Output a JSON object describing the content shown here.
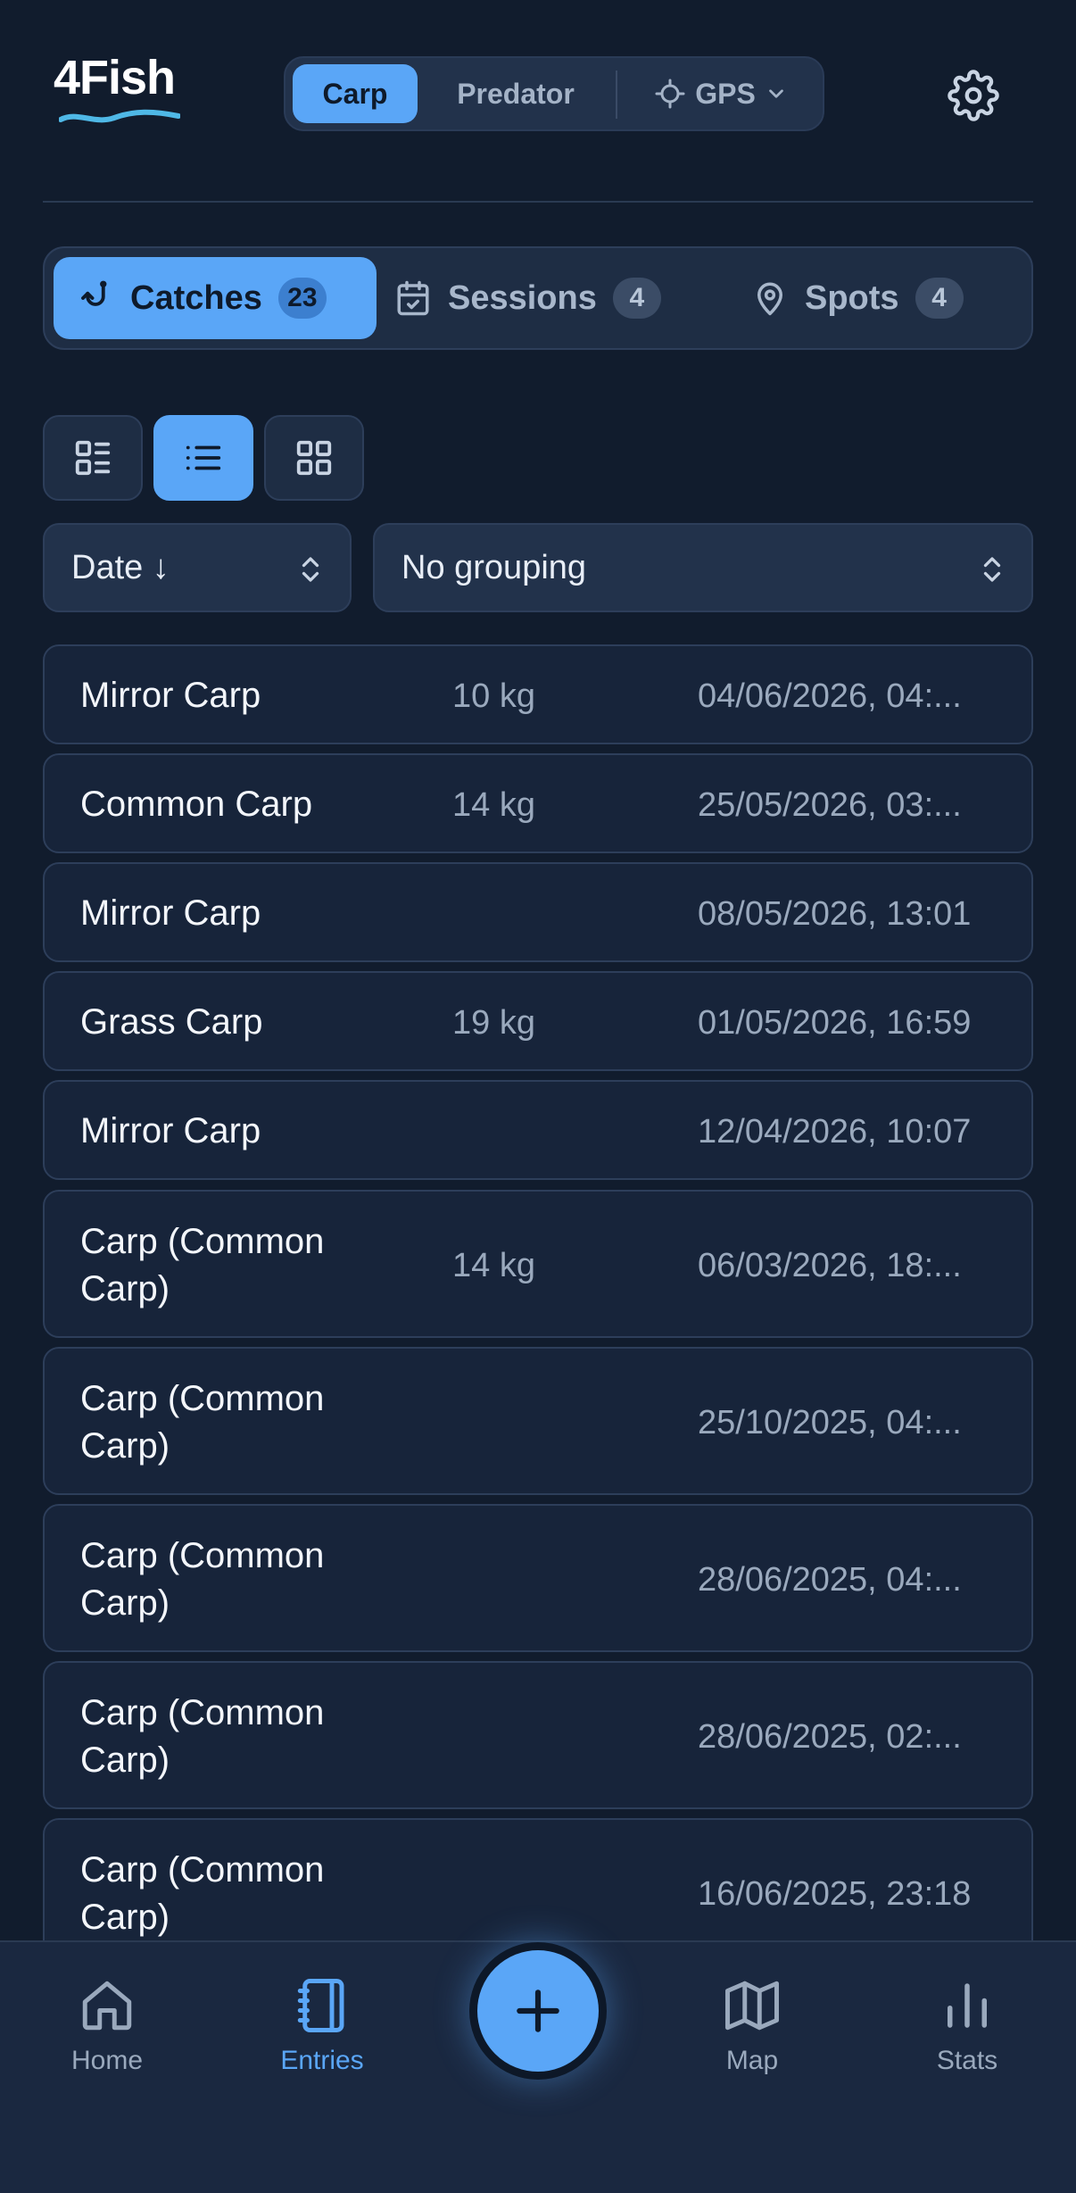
{
  "app": {
    "logo_text": "4Fish"
  },
  "mode_switch": {
    "options": [
      "Carp",
      "Predator"
    ],
    "active": "Carp",
    "location_label": "GPS"
  },
  "tabs": [
    {
      "label": "Catches",
      "count": "23",
      "icon": "fish-hook-icon",
      "active": true
    },
    {
      "label": "Sessions",
      "count": "4",
      "icon": "calendar-check-icon",
      "active": false
    },
    {
      "label": "Spots",
      "count": "4",
      "icon": "map-pin-icon",
      "active": false
    }
  ],
  "view_modes": [
    {
      "icon": "detail-list-icon",
      "active": false
    },
    {
      "icon": "list-icon",
      "active": true
    },
    {
      "icon": "grid-icon",
      "active": false
    }
  ],
  "sort": {
    "value": "Date ↓"
  },
  "grouping": {
    "value": "No grouping"
  },
  "catches": [
    {
      "name": "Mirror Carp",
      "weight": "10 kg",
      "date": "04/06/2026, 04:..."
    },
    {
      "name": "Common Carp",
      "weight": "14 kg",
      "date": "25/05/2026, 03:..."
    },
    {
      "name": "Mirror Carp",
      "weight": "",
      "date": "08/05/2026, 13:01"
    },
    {
      "name": "Grass Carp",
      "weight": "19 kg",
      "date": "01/05/2026, 16:59"
    },
    {
      "name": "Mirror Carp",
      "weight": "",
      "date": "12/04/2026, 10:07"
    },
    {
      "name": "Carp (Common Carp)",
      "weight": "14 kg",
      "date": "06/03/2026, 18:..."
    },
    {
      "name": "Carp (Common Carp)",
      "weight": "",
      "date": "25/10/2025, 04:..."
    },
    {
      "name": "Carp (Common Carp)",
      "weight": "",
      "date": "28/06/2025, 04:..."
    },
    {
      "name": "Carp (Common Carp)",
      "weight": "",
      "date": "28/06/2025, 02:..."
    },
    {
      "name": "Carp (Common Carp)",
      "weight": "",
      "date": "16/06/2025, 23:18"
    }
  ],
  "bottom_nav": [
    {
      "label": "Home",
      "icon": "home-icon",
      "active": false
    },
    {
      "label": "Entries",
      "icon": "notebook-icon",
      "active": true
    },
    {
      "label": "Map",
      "icon": "map-icon",
      "active": false
    },
    {
      "label": "Stats",
      "icon": "bar-chart-icon",
      "active": false
    }
  ],
  "colors": {
    "background": "#111c2d",
    "accent": "#5aa6f7",
    "surface": "#1e2d44",
    "wave": "#4fb8e6"
  }
}
